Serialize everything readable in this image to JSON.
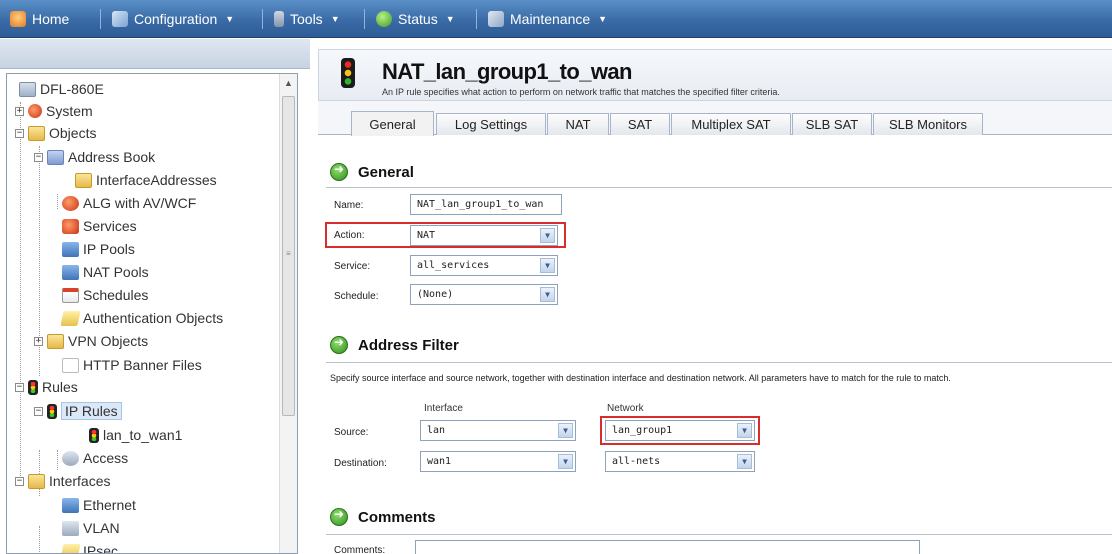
{
  "menubar": {
    "home": "Home",
    "configuration": "Configuration",
    "tools": "Tools",
    "status": "Status",
    "maintenance": "Maintenance",
    "caret": "▼"
  },
  "tree": {
    "root": "DFL-860E",
    "system": "System",
    "objects": "Objects",
    "address_book": "Address Book",
    "interface_addresses": "InterfaceAddresses",
    "alg": "ALG with AV/WCF",
    "services": "Services",
    "ip_pools": "IP Pools",
    "nat_pools": "NAT Pools",
    "schedules": "Schedules",
    "auth_objects": "Authentication Objects",
    "vpn_objects": "VPN Objects",
    "http_banner": "HTTP Banner Files",
    "rules": "Rules",
    "ip_rules": "IP Rules",
    "lan_to_wan1": "lan_to_wan1",
    "access": "Access",
    "interfaces": "Interfaces",
    "ethernet": "Ethernet",
    "vlan": "VLAN",
    "ipsec": "IPsec",
    "expand": "+",
    "collapse": "−"
  },
  "header": {
    "title": "NAT_lan_group1_to_wan",
    "description": "An IP rule specifies what action to perform on network traffic that matches the specified filter criteria."
  },
  "tabs": [
    "General",
    "Log Settings",
    "NAT",
    "SAT",
    "Multiplex SAT",
    "SLB SAT",
    "SLB Monitors"
  ],
  "general": {
    "heading": "General",
    "name_label": "Name:",
    "name_value": "NAT_lan_group1_to_wan",
    "action_label": "Action:",
    "action_value": "NAT",
    "service_label": "Service:",
    "service_value": "all_services",
    "schedule_label": "Schedule:",
    "schedule_value": "(None)"
  },
  "address_filter": {
    "heading": "Address Filter",
    "help": "Specify source interface and source network, together with destination interface and destination network. All parameters have to match for the rule to match.",
    "col_interface": "Interface",
    "col_network": "Network",
    "source_label": "Source:",
    "source_interface": "lan",
    "source_network": "lan_group1",
    "destination_label": "Destination:",
    "destination_interface": "wan1",
    "destination_network": "all-nets"
  },
  "comments": {
    "heading": "Comments",
    "label": "Comments:",
    "value": ""
  },
  "colors": {
    "menubar": "#3a6ba6",
    "highlight": "#d92c2c"
  }
}
